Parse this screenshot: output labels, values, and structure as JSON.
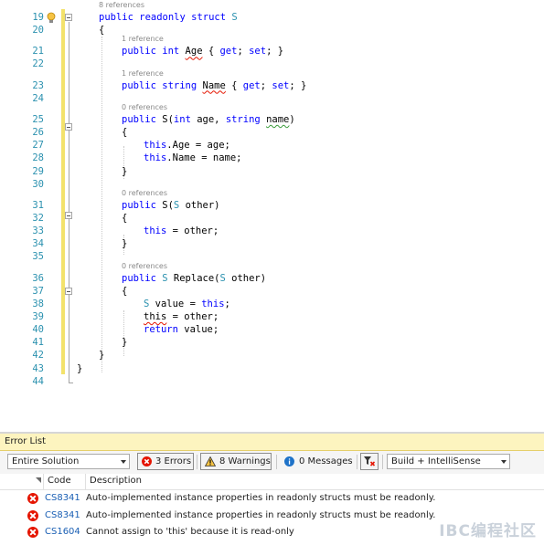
{
  "editor": {
    "lines": [
      {
        "num": "19",
        "lens": "8 references",
        "code": [
          [
            "kw",
            "public readonly struct "
          ],
          [
            "ty",
            "S"
          ]
        ]
      },
      {
        "num": "20",
        "code": [
          [
            "",
            "{"
          ]
        ]
      },
      {
        "num": "21",
        "lens": "1 reference",
        "code": [
          [
            "kw",
            "public int "
          ],
          [
            "sq",
            "Age"
          ],
          [
            "",
            " { "
          ],
          [
            "kw",
            "get"
          ],
          [
            "",
            "; "
          ],
          [
            "kw",
            "set"
          ],
          [
            "",
            "; }"
          ]
        ]
      },
      {
        "num": "22",
        "code": []
      },
      {
        "num": "23",
        "lens": "1 reference",
        "code": [
          [
            "kw",
            "public string "
          ],
          [
            "sq",
            "Name"
          ],
          [
            "",
            " { "
          ],
          [
            "kw",
            "get"
          ],
          [
            "",
            "; "
          ],
          [
            "kw",
            "set"
          ],
          [
            "",
            "; }"
          ]
        ]
      },
      {
        "num": "24",
        "code": []
      },
      {
        "num": "25",
        "lens": "0 references",
        "code": [
          [
            "kw",
            "public "
          ],
          [
            "",
            "S("
          ],
          [
            "kw",
            "int "
          ],
          [
            "",
            "age, "
          ],
          [
            "kw",
            "string "
          ],
          [
            "sqg",
            "name"
          ],
          [
            "",
            ")"
          ]
        ]
      },
      {
        "num": "26",
        "code": [
          [
            "",
            "{"
          ]
        ]
      },
      {
        "num": "27",
        "code": [
          [
            "kw",
            "this"
          ],
          [
            "",
            ".Age = age;"
          ]
        ]
      },
      {
        "num": "28",
        "code": [
          [
            "kw",
            "this"
          ],
          [
            "",
            ".Name = name;"
          ]
        ]
      },
      {
        "num": "29",
        "code": [
          [
            "",
            "}"
          ]
        ]
      },
      {
        "num": "30",
        "code": []
      },
      {
        "num": "31",
        "lens": "0 references",
        "code": [
          [
            "kw",
            "public "
          ],
          [
            "",
            "S("
          ],
          [
            "ty",
            "S"
          ],
          [
            "",
            " other)"
          ]
        ]
      },
      {
        "num": "32",
        "code": [
          [
            "",
            "{"
          ]
        ]
      },
      {
        "num": "33",
        "code": [
          [
            "kw",
            "this"
          ],
          [
            "",
            " = other;"
          ]
        ]
      },
      {
        "num": "34",
        "code": [
          [
            "",
            "}"
          ]
        ]
      },
      {
        "num": "35",
        "code": []
      },
      {
        "num": "36",
        "lens": "0 references",
        "code": [
          [
            "kw",
            "public "
          ],
          [
            "ty",
            "S"
          ],
          [
            "",
            " Replace("
          ],
          [
            "ty",
            "S"
          ],
          [
            "",
            " other)"
          ]
        ]
      },
      {
        "num": "37",
        "code": [
          [
            "",
            "{"
          ]
        ]
      },
      {
        "num": "38",
        "code": [
          [
            "ty",
            "S"
          ],
          [
            "",
            " value = "
          ],
          [
            "kw",
            "this"
          ],
          [
            "",
            ";"
          ]
        ]
      },
      {
        "num": "39",
        "code": [
          [
            "sq",
            "this"
          ],
          [
            "",
            " = other;"
          ]
        ]
      },
      {
        "num": "40",
        "code": [
          [
            "kw",
            "return"
          ],
          [
            "",
            " value;"
          ]
        ]
      },
      {
        "num": "41",
        "code": [
          [
            "",
            "}"
          ]
        ]
      },
      {
        "num": "42",
        "code": [
          [
            "",
            "}"
          ]
        ]
      },
      {
        "num": "43",
        "code": [
          [
            "",
            "}"
          ]
        ]
      },
      {
        "num": "44",
        "code": []
      }
    ]
  },
  "error_list": {
    "title": "Error List",
    "scope": "Entire Solution",
    "errors_label": "3 Errors",
    "warnings_label": "8 Warnings",
    "messages_label": "0 Messages",
    "build_filter": "Build + IntelliSense",
    "col_code": "Code",
    "col_description": "Description",
    "rows": [
      {
        "code": "CS8341",
        "description": "Auto-implemented instance properties in readonly structs must be readonly."
      },
      {
        "code": "CS8341",
        "description": "Auto-implemented instance properties in readonly structs must be readonly."
      },
      {
        "code": "CS1604",
        "description": "Cannot assign to 'this' because it is read-only"
      }
    ]
  },
  "watermark": "IBC编程社区",
  "colors": {
    "keyword": "#0000ff",
    "type": "#2b91af",
    "error": "#e51400",
    "title_bar": "#fdf4bf"
  }
}
